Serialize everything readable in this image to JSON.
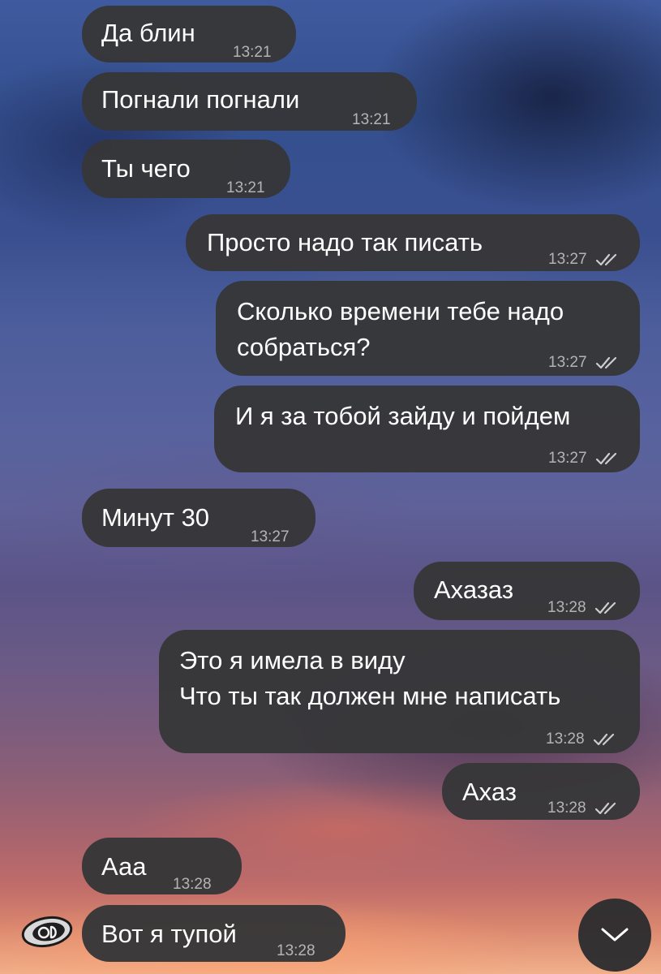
{
  "messages": [
    {
      "text": "Да блин",
      "time": "13:21",
      "direction": "incoming"
    },
    {
      "text": "Погнали погнали",
      "time": "13:21",
      "direction": "incoming"
    },
    {
      "text": "Ты чего",
      "time": "13:21",
      "direction": "incoming"
    },
    {
      "text": "Просто надо так писать",
      "time": "13:27",
      "direction": "outgoing",
      "status": "read"
    },
    {
      "text": "Сколько времени тебе надо\nсобраться?",
      "time": "13:27",
      "direction": "outgoing",
      "status": "read"
    },
    {
      "text": "И я за тобой зайду и пойдем",
      "time": "13:27",
      "direction": "outgoing",
      "status": "read"
    },
    {
      "text": "Минут 30",
      "time": "13:27",
      "direction": "incoming"
    },
    {
      "text": "Ахазаз",
      "time": "13:28",
      "direction": "outgoing",
      "status": "read"
    },
    {
      "text": "Это я имела в виду\nЧто ты так должен мне написать",
      "time": "13:28",
      "direction": "outgoing",
      "status": "read"
    },
    {
      "text": "Ахаз",
      "time": "13:28",
      "direction": "outgoing",
      "status": "read"
    },
    {
      "text": "Ааа",
      "time": "13:28",
      "direction": "incoming"
    },
    {
      "text": "Вот я тупой",
      "time": "13:28",
      "direction": "incoming"
    }
  ],
  "icons": {
    "read_status": "double-check-icon",
    "scroll_down": "chevron-down-icon",
    "sender_avatar": "avatar"
  },
  "colors": {
    "bubble": "#373739",
    "text": "#ffffff",
    "meta": "#9e9ea2"
  }
}
